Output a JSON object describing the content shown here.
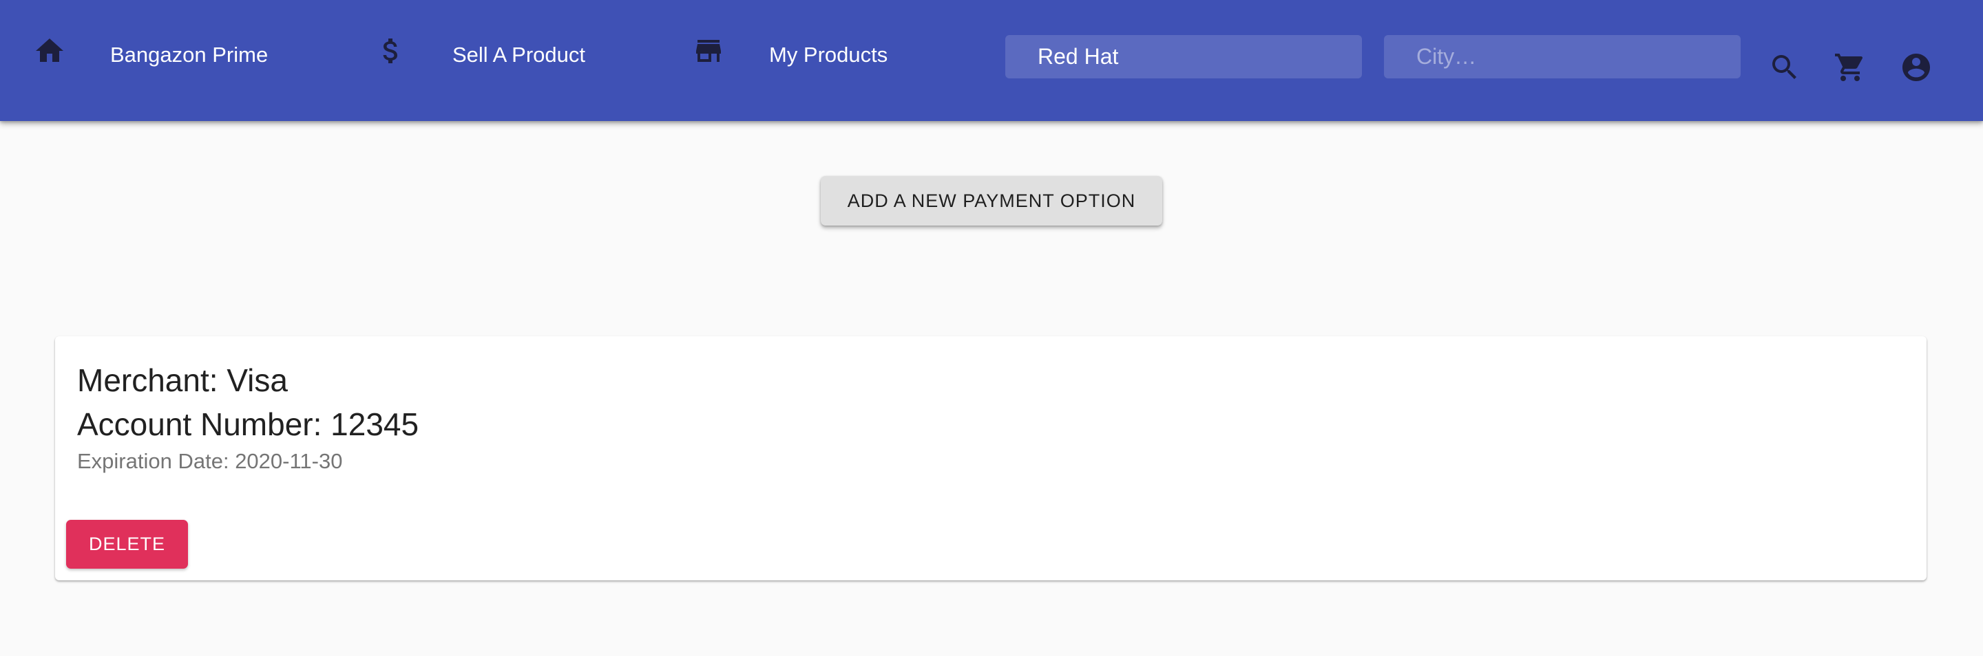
{
  "colors": {
    "appbar": "#3f51b5",
    "icon": "#1d1f3d",
    "page_background": "#fafafa",
    "add_button": "#e0e0e0",
    "delete_button": "#e0305b",
    "secondary_text": "#757575"
  },
  "nav": {
    "items": [
      {
        "icon": "home-icon",
        "label": "Bangazon Prime"
      },
      {
        "icon": "dollar-icon",
        "label": "Sell A Product"
      },
      {
        "icon": "store-icon",
        "label": "My Products"
      }
    ]
  },
  "search": {
    "product_value": "Red Hat",
    "city_placeholder": "City…"
  },
  "toolbar": {
    "icons": [
      "search-icon",
      "cart-icon",
      "account-circle-icon"
    ]
  },
  "main": {
    "add_payment_label": "ADD A NEW PAYMENT OPTION"
  },
  "payment": {
    "merchant_label": "Merchant:",
    "merchant": "Visa",
    "account_label": "Account Number:",
    "account_number": "12345",
    "expiration_label": "Expiration Date:",
    "expiration_date": "2020-11-30",
    "delete_label": "DELETE"
  }
}
